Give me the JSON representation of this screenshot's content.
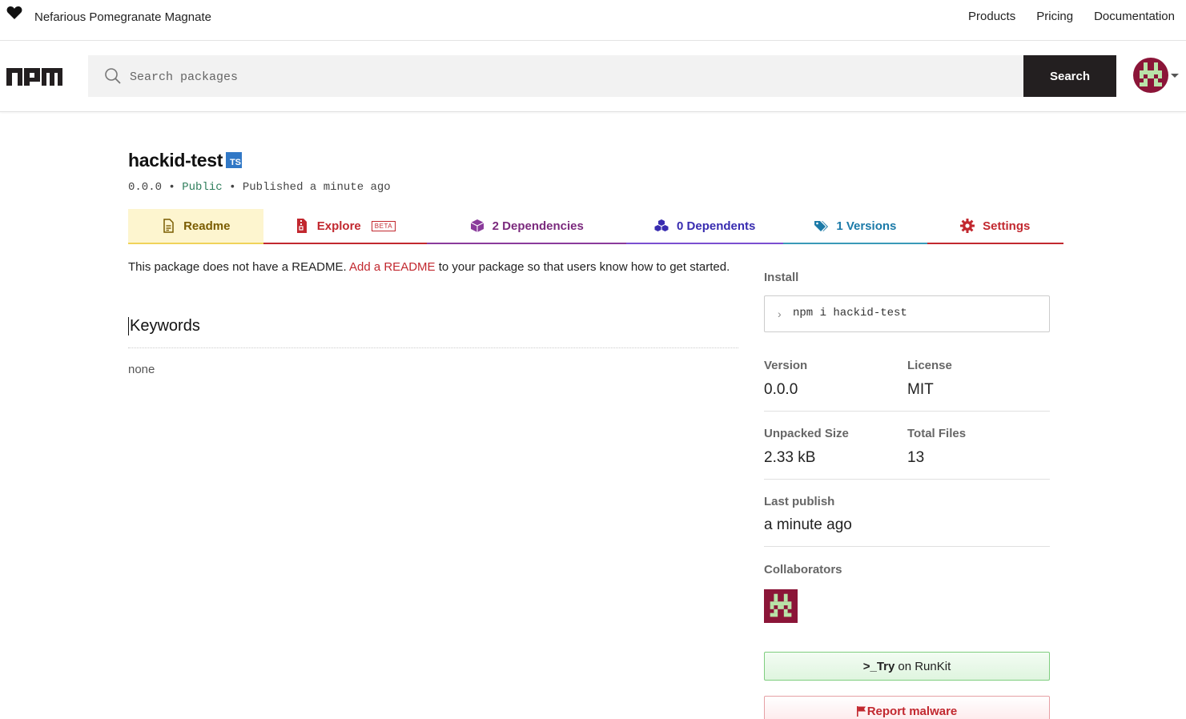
{
  "topbar": {
    "tagline": "Nefarious Pomegranate Magnate",
    "nav": [
      "Products",
      "Pricing",
      "Documentation"
    ]
  },
  "search": {
    "placeholder": "Search packages",
    "button_label": "Search"
  },
  "package": {
    "name": "hackid-test",
    "ts_badge": "TS",
    "version": "0.0.0",
    "visibility": "Public",
    "published": "Published a minute ago",
    "separator": "•"
  },
  "tabs": [
    {
      "label": "Readme",
      "icon": "document-icon"
    },
    {
      "label": "Explore",
      "icon": "file-zip-icon",
      "badge": "BETA"
    },
    {
      "label": "2 Dependencies",
      "icon": "box-icon"
    },
    {
      "label": "0 Dependents",
      "icon": "boxes-icon"
    },
    {
      "label": "1 Versions",
      "icon": "tags-icon"
    },
    {
      "label": "Settings",
      "icon": "gear-icon"
    }
  ],
  "readme": {
    "text_before": "This package does not have a README. ",
    "link": "Add a README",
    "text_after": " to your package so that users know how to get started."
  },
  "keywords": {
    "title": "Keywords",
    "value": "none"
  },
  "sidebar": {
    "install_label": "Install",
    "install_cmd": "npm i hackid-test",
    "version_label": "Version",
    "version_value": "0.0.0",
    "license_label": "License",
    "license_value": "MIT",
    "unpacked_label": "Unpacked Size",
    "unpacked_value": "2.33 kB",
    "files_label": "Total Files",
    "files_value": "13",
    "last_publish_label": "Last publish",
    "last_publish_value": "a minute ago",
    "collaborators_label": "Collaborators",
    "runkit_try": ">_Try",
    "runkit_rest": "on RunKit",
    "report_label": "Report malware"
  },
  "colors": {
    "npm_red": "#c2282f",
    "avatar_bg": "#8b1538",
    "avatar_fg": "#b9e3a8"
  }
}
